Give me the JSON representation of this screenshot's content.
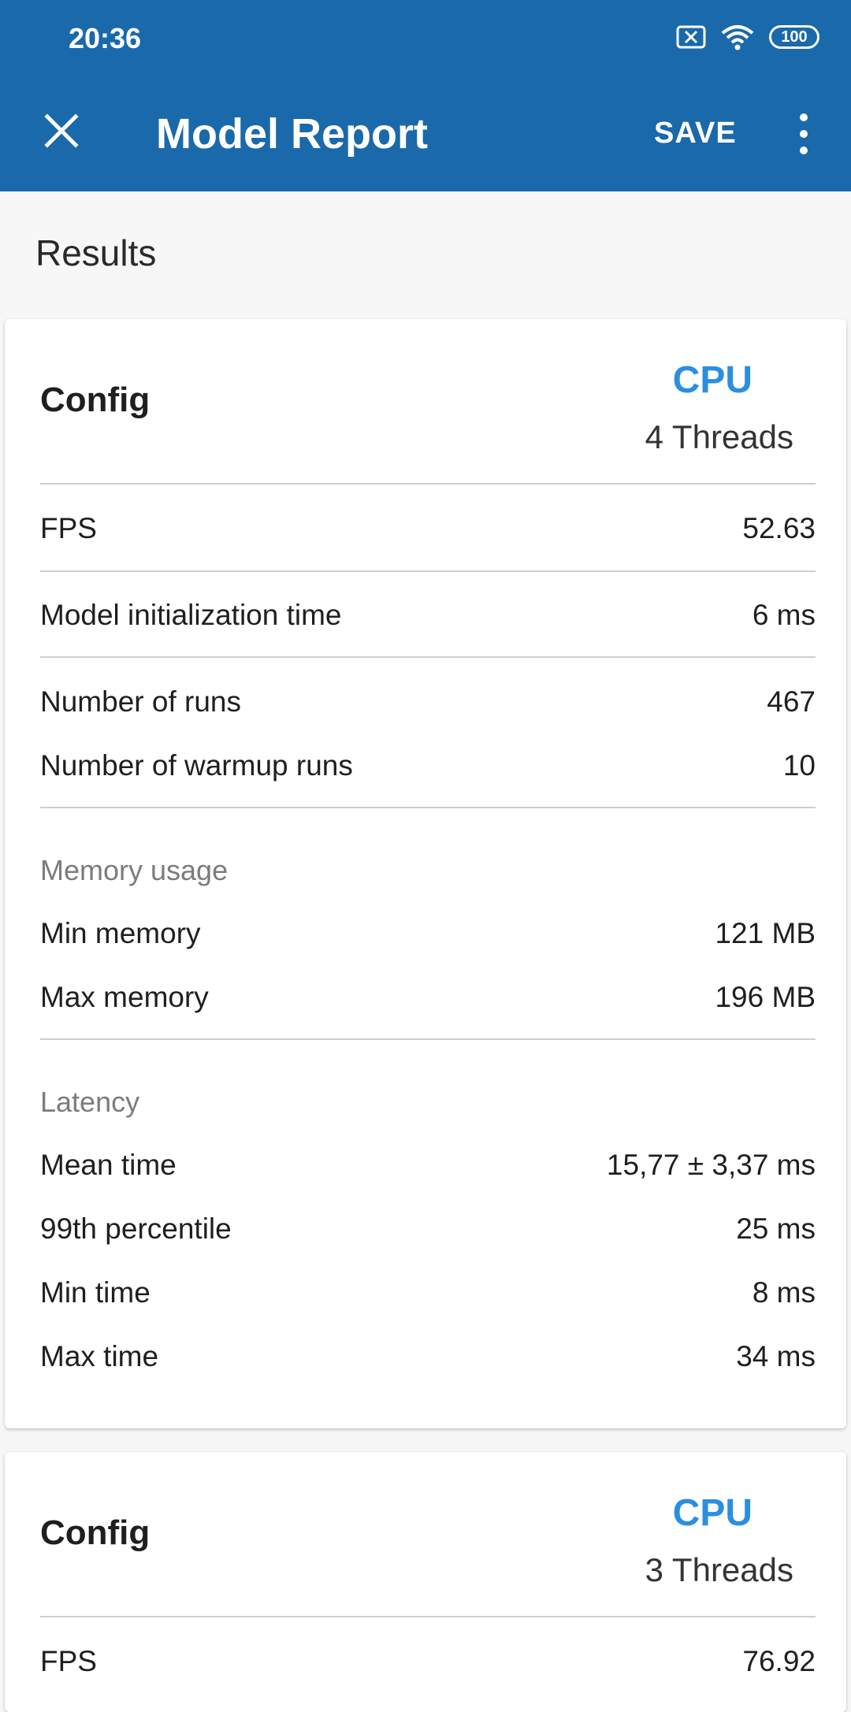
{
  "status_bar": {
    "time": "20:36",
    "battery": "100",
    "icons": [
      "close-box-icon",
      "wifi-icon",
      "battery-icon"
    ]
  },
  "toolbar": {
    "close_icon": "close-icon",
    "title": "Model Report",
    "save_label": "SAVE",
    "more_icon": "more-vert-icon"
  },
  "section_title": "Results",
  "colors": {
    "appbar": "#1a69aa",
    "accent": "#2b8fe0"
  },
  "cards": [
    {
      "config_label": "Config",
      "device": "CPU",
      "threads": "4 Threads",
      "fps": {
        "label": "FPS",
        "value": "52.63"
      },
      "init": {
        "label": "Model initialization time",
        "value": "6 ms"
      },
      "runs": {
        "label": "Number of runs",
        "value": "467"
      },
      "warmup": {
        "label": "Number of warmup runs",
        "value": "10"
      },
      "memory": {
        "heading": "Memory usage",
        "min": {
          "label": "Min memory",
          "value": "121 MB"
        },
        "max": {
          "label": "Max memory",
          "value": "196 MB"
        }
      },
      "latency": {
        "heading": "Latency",
        "mean": {
          "label": "Mean time",
          "value": "15,77 ± 3,37 ms"
        },
        "p99": {
          "label": "99th percentile",
          "value": "25 ms"
        },
        "min": {
          "label": "Min time",
          "value": "8 ms"
        },
        "max": {
          "label": "Max time",
          "value": "34 ms"
        }
      }
    },
    {
      "config_label": "Config",
      "device": "CPU",
      "threads": "3 Threads",
      "fps": {
        "label": "FPS",
        "value": "76.92"
      }
    }
  ]
}
